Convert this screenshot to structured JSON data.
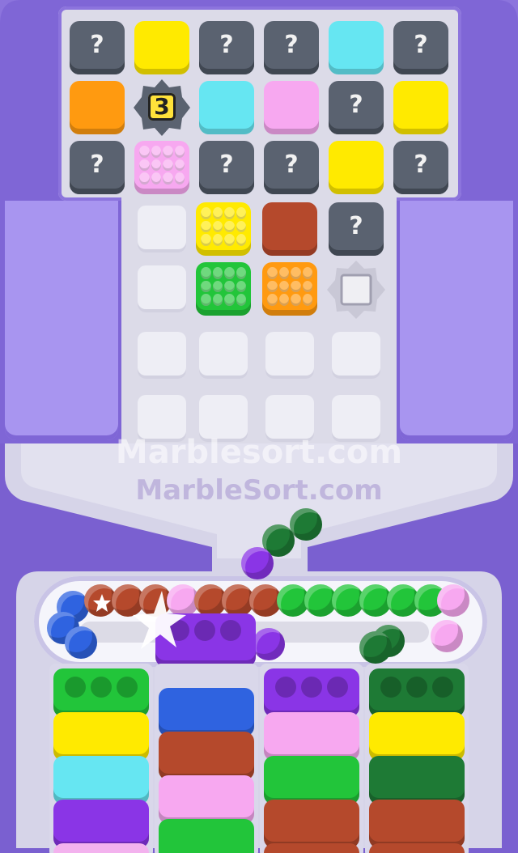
{
  "colors": {
    "gray": "#5a6270",
    "yellow": "#ffea00",
    "orange": "#ff9a10",
    "cyan": "#66e6f2",
    "pink": "#f7a8f0",
    "brown": "#b5492c",
    "green": "#22c53a",
    "darkgreen": "#1e7a35",
    "blue": "#2f63e0",
    "purple": "#8a35e6",
    "lightpink": "#f3b2ee",
    "brightyellow": "#ffe600"
  },
  "board": {
    "question_mark": "?",
    "lock_count": "3",
    "rows": [
      [
        "hidden",
        "yellow",
        "hidden",
        "hidden",
        "cyan",
        "hidden"
      ],
      [
        "orange",
        "lock",
        "cyan",
        "pink",
        "hidden",
        "yellow"
      ],
      [
        "hidden",
        "pink-pegs",
        "hidden",
        "hidden",
        "yellow",
        "hidden"
      ]
    ],
    "stem_rows": [
      [
        "empty",
        "yellow-pegs",
        "brown",
        "hidden"
      ],
      [
        "empty",
        "green-pegs",
        "orange-pegs",
        "white-frame"
      ],
      [
        "empty",
        "empty",
        "empty",
        "empty"
      ],
      [
        "empty",
        "empty",
        "empty",
        "empty"
      ]
    ]
  },
  "watermarks": {
    "primary": "Marblesort.com",
    "secondary": "MarbleSort.com"
  },
  "conveyor": {
    "active_tray": "purple",
    "top_marbles": [
      "blue",
      "brown",
      "brown",
      "brown",
      "pink",
      "brown",
      "brown",
      "brown",
      "green",
      "green",
      "green",
      "green",
      "green",
      "green",
      "pink"
    ],
    "falling_marbles": [
      "darkgreen",
      "darkgreen",
      "purple"
    ]
  },
  "tray_columns": [
    [
      "green",
      "yellow",
      "cyan",
      "purple",
      "lightpink"
    ],
    [
      "blue",
      "brown",
      "pink",
      "green"
    ],
    [
      "purple",
      "pink",
      "green",
      "brown",
      "brown"
    ],
    [
      "darkgreen",
      "yellow",
      "darkgreen",
      "brown",
      "brown"
    ]
  ]
}
